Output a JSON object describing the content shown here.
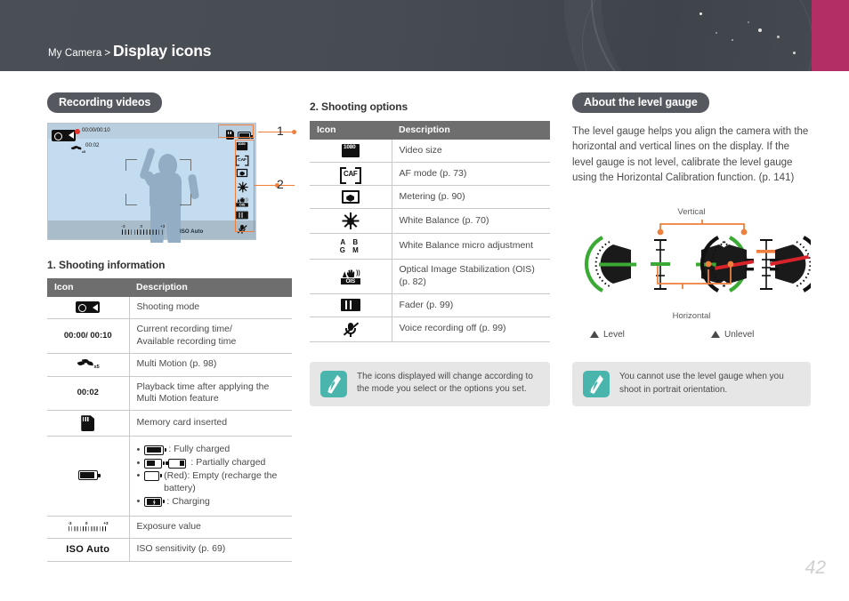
{
  "header": {
    "breadcrumb_parent": "My Camera",
    "breadcrumb_separator": ">",
    "title": "Display icons",
    "accent_color": "#b32e62",
    "bar_color": "#474c53"
  },
  "left_column": {
    "pill_heading": "Recording videos",
    "preview": {
      "recording_time": "00:00/00:10",
      "multi_motion_time": "00:02",
      "iso_label": "ISO Auto",
      "ev_minus": "-3",
      "ev_zero": "0",
      "ev_plus": "+3",
      "callout_1": "1",
      "callout_2": "2",
      "highlight_color": "#ef7f3d"
    },
    "section_title": "1. Shooting information",
    "table": {
      "headers": [
        "Icon",
        "Description"
      ],
      "rows": [
        {
          "icon": "shooting-mode-icon",
          "icon_text": "",
          "desc": "Shooting mode"
        },
        {
          "icon": "recording-time-text",
          "icon_text": "00:00/ 00:10",
          "desc": "Current recording time/\nAvailable recording time"
        },
        {
          "icon": "multi-motion-icon",
          "icon_text": "",
          "desc": "Multi Motion (p. 98)"
        },
        {
          "icon": "playback-time-text",
          "icon_text": "00:02",
          "desc": "Playback time after applying the Multi Motion feature"
        },
        {
          "icon": "memory-card-icon",
          "icon_text": "",
          "desc": "Memory card inserted"
        },
        {
          "icon": "battery-icon",
          "icon_text": "",
          "desc": "battery-list"
        },
        {
          "icon": "exposure-value-icon",
          "icon_text": "",
          "desc": "Exposure value"
        },
        {
          "icon": "iso-text",
          "icon_text": "ISO Auto",
          "desc": "ISO sensitivity (p. 69)"
        }
      ],
      "battery_items": [
        ": Fully charged",
        ": Partially charged",
        " (Red): Empty (recharge the battery)",
        ": Charging"
      ]
    }
  },
  "middle_column": {
    "section_title": "2. Shooting options",
    "table": {
      "headers": [
        "Icon",
        "Description"
      ],
      "rows": [
        {
          "icon": "video-size-icon",
          "desc": "Video size"
        },
        {
          "icon": "af-mode-icon",
          "desc": "AF mode (p. 73)"
        },
        {
          "icon": "metering-icon",
          "desc": "Metering (p. 90)"
        },
        {
          "icon": "white-balance-icon",
          "desc": "White Balance (p. 70)"
        },
        {
          "icon": "wb-micro-adjust-icon",
          "desc": "White Balance micro adjustment"
        },
        {
          "icon": "ois-icon",
          "desc": "Optical Image Stabilization (OIS) (p. 82)"
        },
        {
          "icon": "fader-icon",
          "desc": "Fader (p. 99)"
        },
        {
          "icon": "voice-recording-off-icon",
          "desc": "Voice recording off (p. 99)"
        }
      ]
    },
    "tip": "The icons displayed will change according to the mode you select or the options you set."
  },
  "right_column": {
    "pill_heading": "About the level gauge",
    "body": "The level gauge helps you align the camera with the horizontal and vertical lines on the display. If the level gauge is not level, calibrate the level gauge using the Horizontal Calibration function. (p. 141)",
    "diagram": {
      "label_vertical": "Vertical",
      "label_horizontal": "Horizontal",
      "legend_level": "Level",
      "legend_unlevel": "Unlevel",
      "level_color": "#3aaa35",
      "unlevel_color": "#d8232a",
      "connector_color": "#ef7f3d"
    },
    "tip": "You cannot use the level gauge when you shoot in portrait orientation."
  },
  "footer": {
    "page_number": "42"
  }
}
